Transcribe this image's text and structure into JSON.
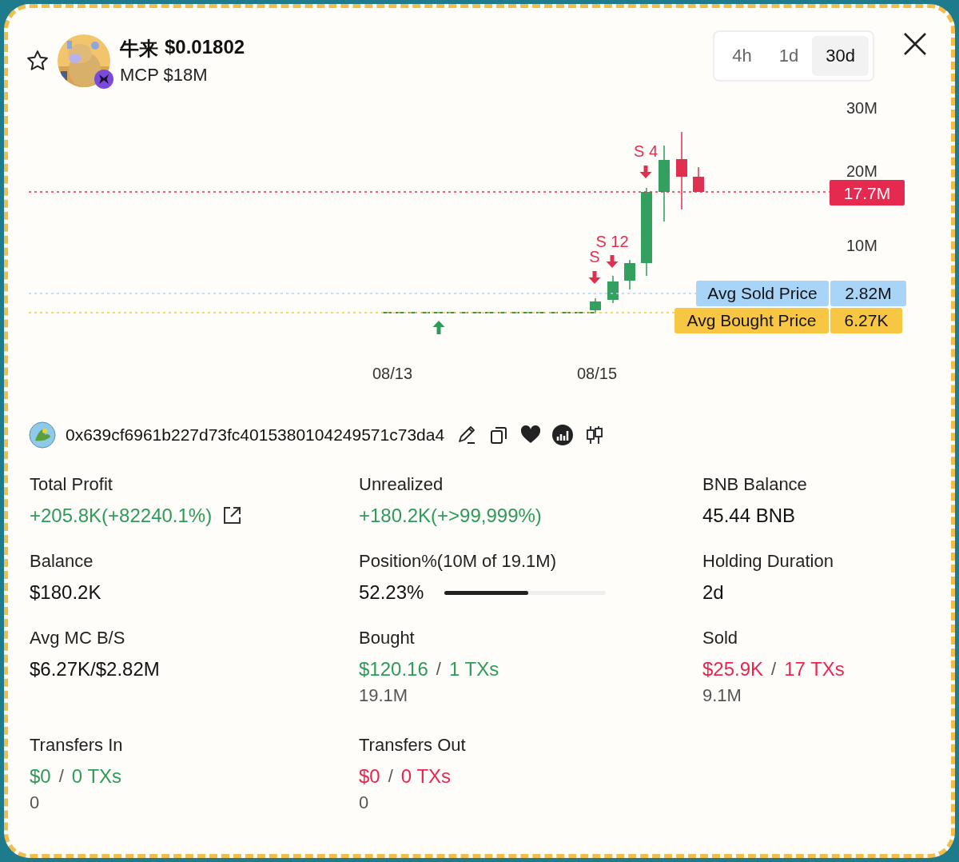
{
  "header": {
    "favorited": false,
    "token_name": "牛来",
    "price": "$0.01802",
    "market_cap": "MCP $18M"
  },
  "timeframes": [
    {
      "label": "4h",
      "selected": false
    },
    {
      "label": "1d",
      "selected": false
    },
    {
      "label": "30d",
      "selected": true
    }
  ],
  "chart": {
    "y_labels": [
      "30M",
      "20M",
      "10M"
    ],
    "x_labels": [
      "08/13",
      "08/15"
    ],
    "current_price": "17.7M",
    "avg_lines": [
      {
        "kind": "sold",
        "label": "Avg Sold Price",
        "value": "2.82M",
        "color": "#a8d5f7"
      },
      {
        "kind": "bought",
        "label": "Avg Bought Price",
        "value": "6.27K",
        "color": "#f7c744"
      }
    ],
    "markers": [
      {
        "kind": "sell",
        "label": "S 4"
      },
      {
        "kind": "sell",
        "label": "S 12"
      },
      {
        "kind": "sell",
        "label": "S"
      },
      {
        "kind": "buy"
      }
    ]
  },
  "wallet": {
    "address": "0x639cf6961b227d73fc4015380104249571c73da4"
  },
  "stats": [
    {
      "label": "Total Profit",
      "value": "+205.8K(+82240.1%)",
      "color": "#2e9b5a",
      "link": true
    },
    {
      "label": "Unrealized",
      "value": "+180.2K(+>99,999%)",
      "color": "#2e9b5a"
    },
    {
      "label": "BNB Balance",
      "value": "45.44 BNB",
      "color": "#111111"
    },
    {
      "label": "Balance",
      "value": "$180.2K",
      "color": "#111111"
    },
    {
      "label": "Position%(10M of 19.1M)",
      "value": "52.23%",
      "color": "#111111",
      "level": 0.52
    },
    {
      "label": "Holding Duration",
      "value": "2d",
      "color": "#111111"
    },
    {
      "label": "Avg MC B/S",
      "value": "$6.27K/$2.82M",
      "color": "#111111"
    },
    {
      "label": "Bought",
      "value": "$120.16",
      "separator": "/",
      "txs": "1 TXs",
      "sub": "19.1M",
      "color": "#2e9b5a"
    },
    {
      "label": "Sold",
      "value": "$25.9K",
      "separator": "/",
      "txs": "17 TXs",
      "sub": "9.1M",
      "color": "#e8264f"
    },
    {
      "label": "Transfers In",
      "value": "$0",
      "separator": "/",
      "txs": "0 TXs",
      "sub": "0",
      "color": "#2e9b5a"
    },
    {
      "label": "Transfers Out",
      "value": "$0",
      "separator": "/",
      "txs": "0 TXs",
      "sub": "0",
      "color": "#e8264f"
    }
  ]
}
